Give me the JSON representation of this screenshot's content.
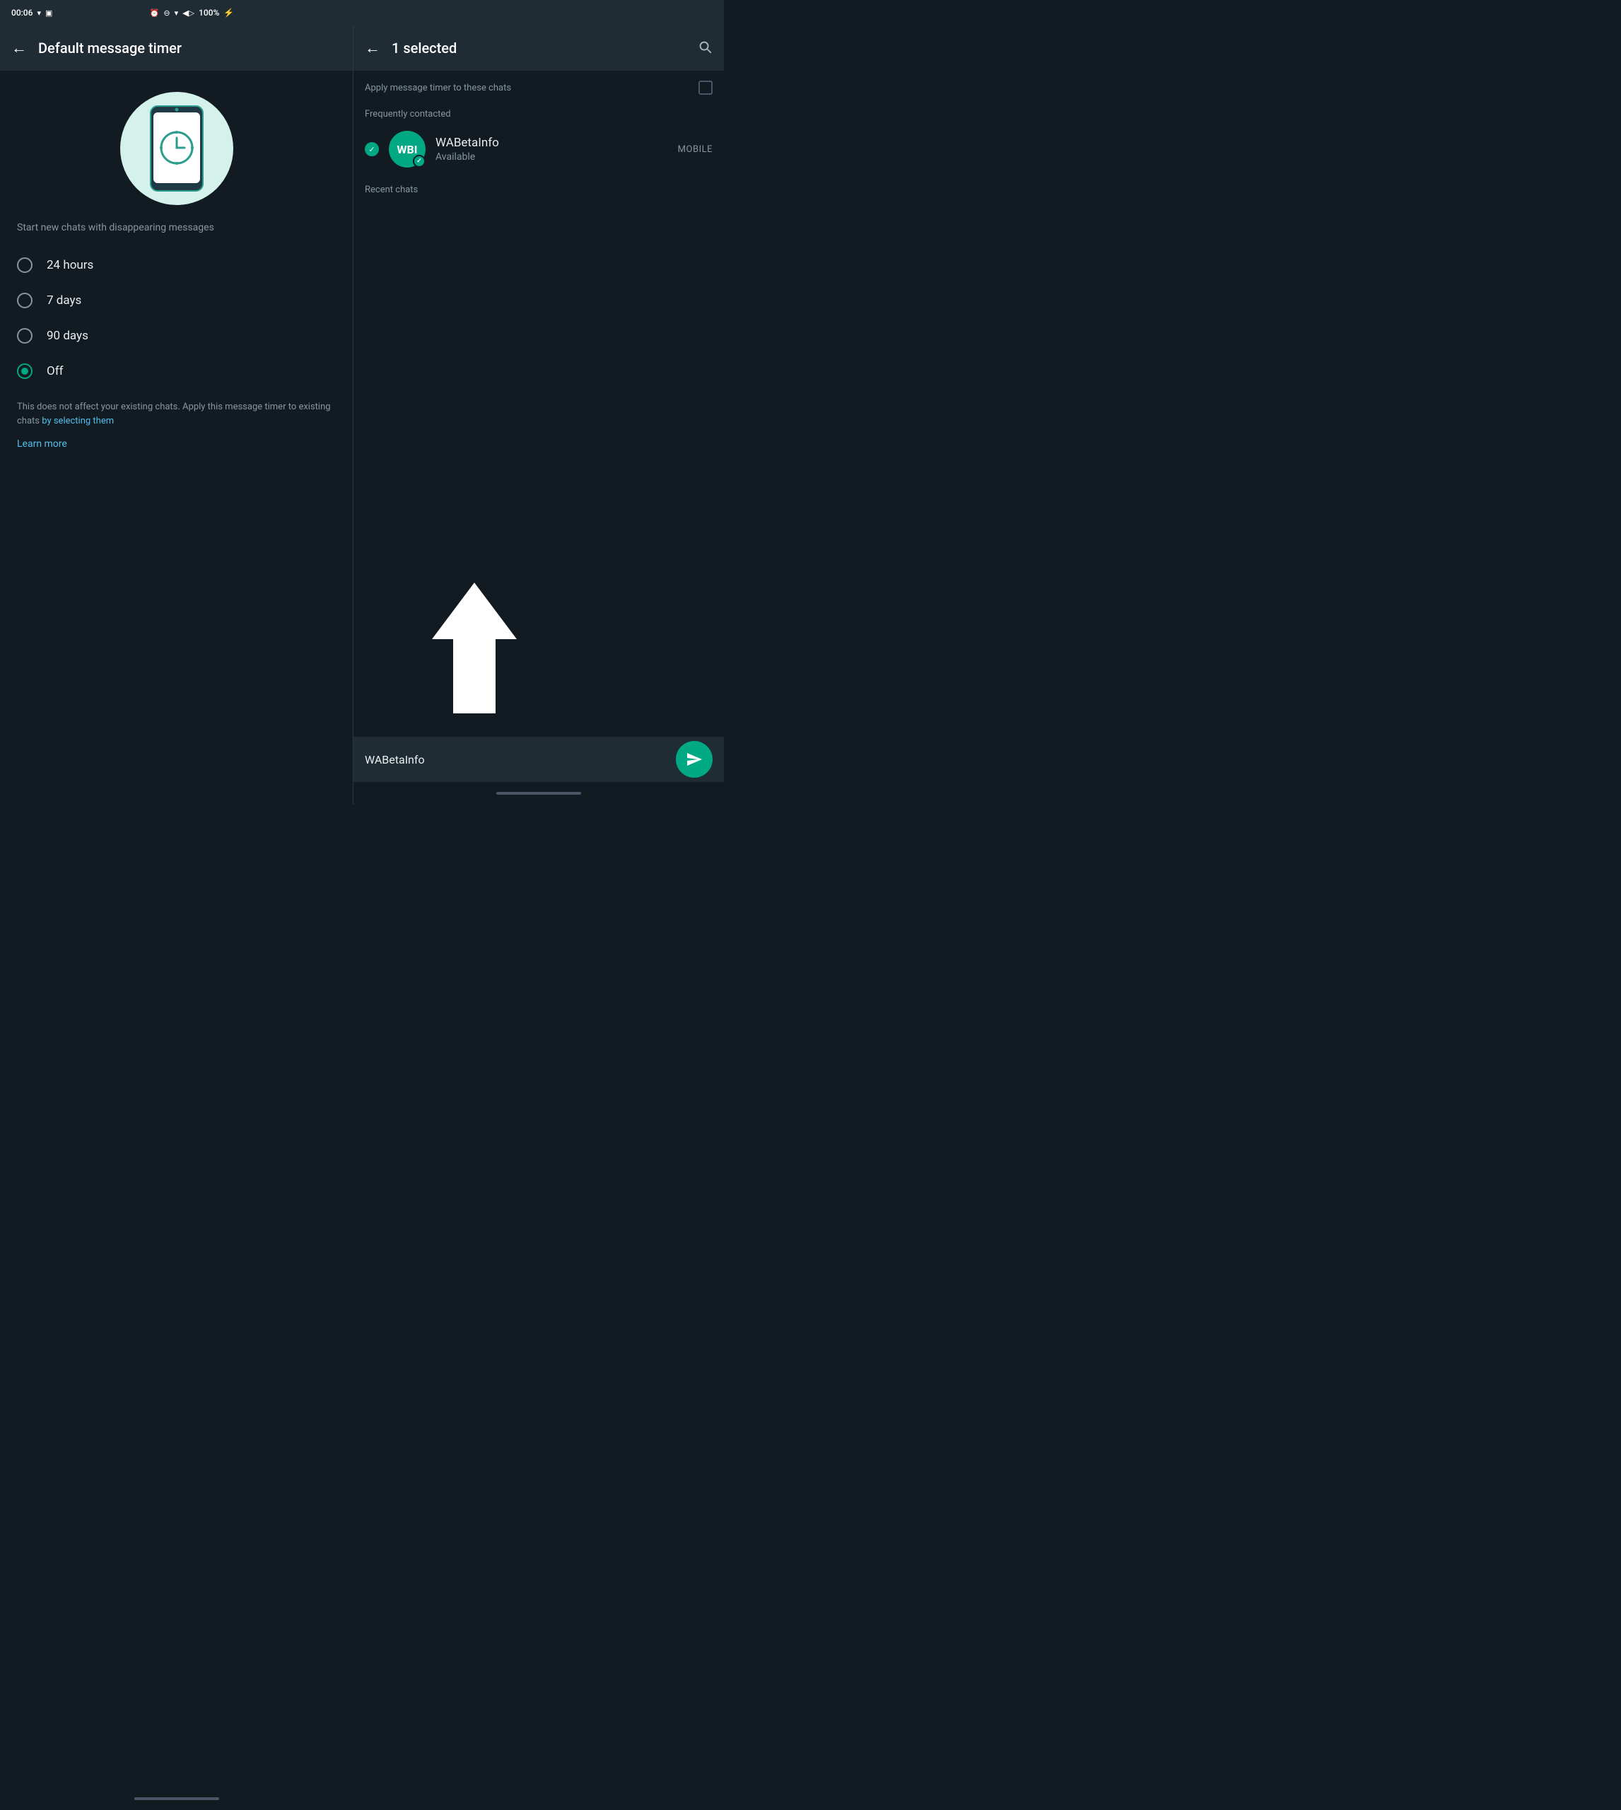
{
  "statusBar": {
    "left": {
      "time": "00:06"
    },
    "right": {
      "battery": "100%",
      "charging": "⚡"
    }
  },
  "leftPanel": {
    "header": {
      "backLabel": "←",
      "title": "Default message timer"
    },
    "subtitle": "Start new chats with disappearing messages",
    "options": [
      {
        "label": "24 hours",
        "selected": false
      },
      {
        "label": "7 days",
        "selected": false
      },
      {
        "label": "90 days",
        "selected": false
      },
      {
        "label": "Off",
        "selected": true
      }
    ],
    "infoText": "This does not affect your existing chats. Apply this message timer to existing chats ",
    "infoLink": "by selecting them",
    "learnMore": "Learn more"
  },
  "rightPanel": {
    "header": {
      "backLabel": "←",
      "selectedCount": "1 selected",
      "searchLabel": "🔍"
    },
    "applyTimerLabel": "Apply  message timer to these chats",
    "frequentlyContactedLabel": "Frequently contacted",
    "contacts": [
      {
        "name": "WABetaInfo",
        "status": "Available",
        "badge": "MOBILE",
        "avatarText": "WBI",
        "selected": true
      }
    ],
    "recentChatsLabel": "Recent chats",
    "bottomBar": {
      "name": "WABetaInfo",
      "sendLabel": "Send"
    }
  }
}
